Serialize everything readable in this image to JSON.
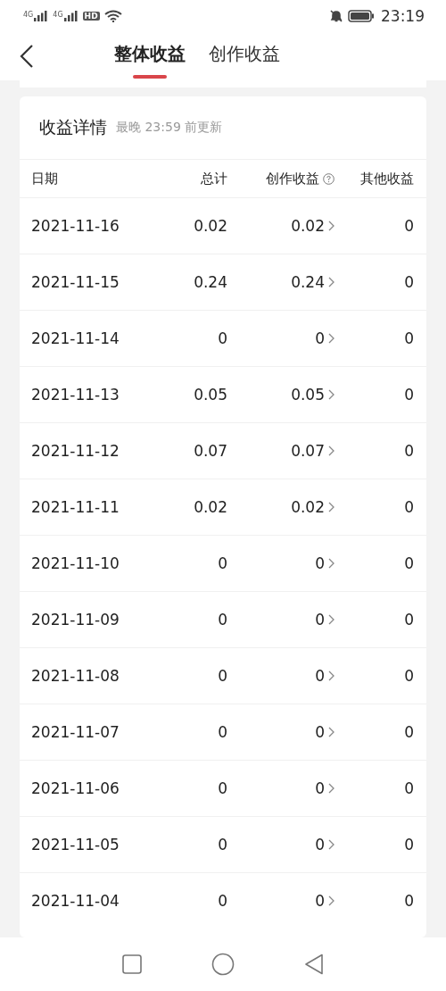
{
  "status_bar": {
    "network_labels": [
      "4G",
      "4G"
    ],
    "hd_label": "HD",
    "time": "23:19"
  },
  "tabs": [
    {
      "label": "整体收益",
      "selected": true
    },
    {
      "label": "创作收益",
      "selected": false
    }
  ],
  "card": {
    "title": "收益详情",
    "subtitle": "最晚 23:59 前更新"
  },
  "table": {
    "columns": [
      "日期",
      "总计",
      "创作收益",
      "其他收益"
    ],
    "rows": [
      {
        "date": "2021-11-16",
        "total": "0.02",
        "creation": "0.02",
        "other": "0"
      },
      {
        "date": "2021-11-15",
        "total": "0.24",
        "creation": "0.24",
        "other": "0"
      },
      {
        "date": "2021-11-14",
        "total": "0",
        "creation": "0",
        "other": "0"
      },
      {
        "date": "2021-11-13",
        "total": "0.05",
        "creation": "0.05",
        "other": "0"
      },
      {
        "date": "2021-11-12",
        "total": "0.07",
        "creation": "0.07",
        "other": "0"
      },
      {
        "date": "2021-11-11",
        "total": "0.02",
        "creation": "0.02",
        "other": "0"
      },
      {
        "date": "2021-11-10",
        "total": "0",
        "creation": "0",
        "other": "0"
      },
      {
        "date": "2021-11-09",
        "total": "0",
        "creation": "0",
        "other": "0"
      },
      {
        "date": "2021-11-08",
        "total": "0",
        "creation": "0",
        "other": "0"
      },
      {
        "date": "2021-11-07",
        "total": "0",
        "creation": "0",
        "other": "0"
      },
      {
        "date": "2021-11-06",
        "total": "0",
        "creation": "0",
        "other": "0"
      },
      {
        "date": "2021-11-05",
        "total": "0",
        "creation": "0",
        "other": "0"
      },
      {
        "date": "2021-11-04",
        "total": "0",
        "creation": "0",
        "other": "0"
      }
    ]
  }
}
